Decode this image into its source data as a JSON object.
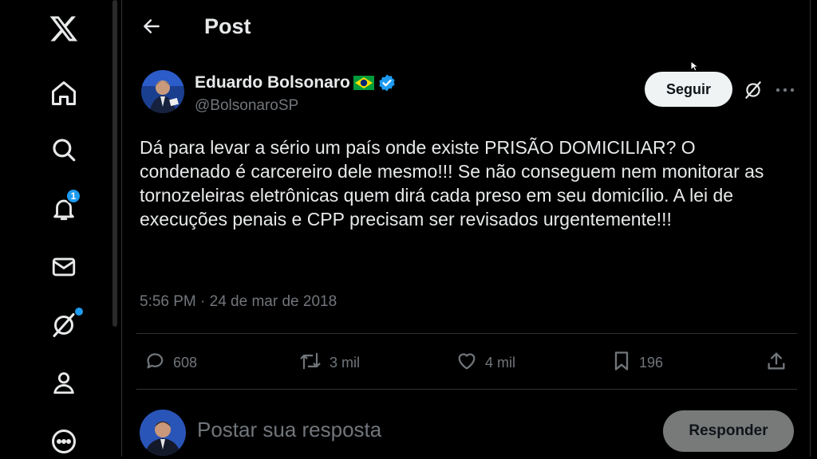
{
  "nav": {
    "notifications_badge": "1"
  },
  "header": {
    "title": "Post"
  },
  "post": {
    "author_name": "Eduardo Bolsonaro",
    "author_flag": "🇧🇷",
    "handle": "@BolsonaroSP",
    "follow_label": "Seguir",
    "text": "Dá para levar a sério um país onde existe PRISÃO DOMICILIAR? O condenado é carcereiro dele mesmo!!! Se não conseguem nem monitorar as tornozeleiras eletrônicas quem dirá cada preso em seu domicílio. A lei de execuções penais e CPP precisam ser revisados urgentemente!!!",
    "timestamp": "5:56 PM · 24 de mar de 2018",
    "stats": {
      "replies": "608",
      "reposts": "3 mil",
      "likes": "4 mil",
      "bookmarks": "196"
    }
  },
  "reply": {
    "placeholder": "Postar sua resposta",
    "button_label": "Responder"
  },
  "colors": {
    "background": "#000000",
    "text": "#e7e9ea",
    "secondary": "#71767b",
    "accent": "#1d9bf0"
  }
}
